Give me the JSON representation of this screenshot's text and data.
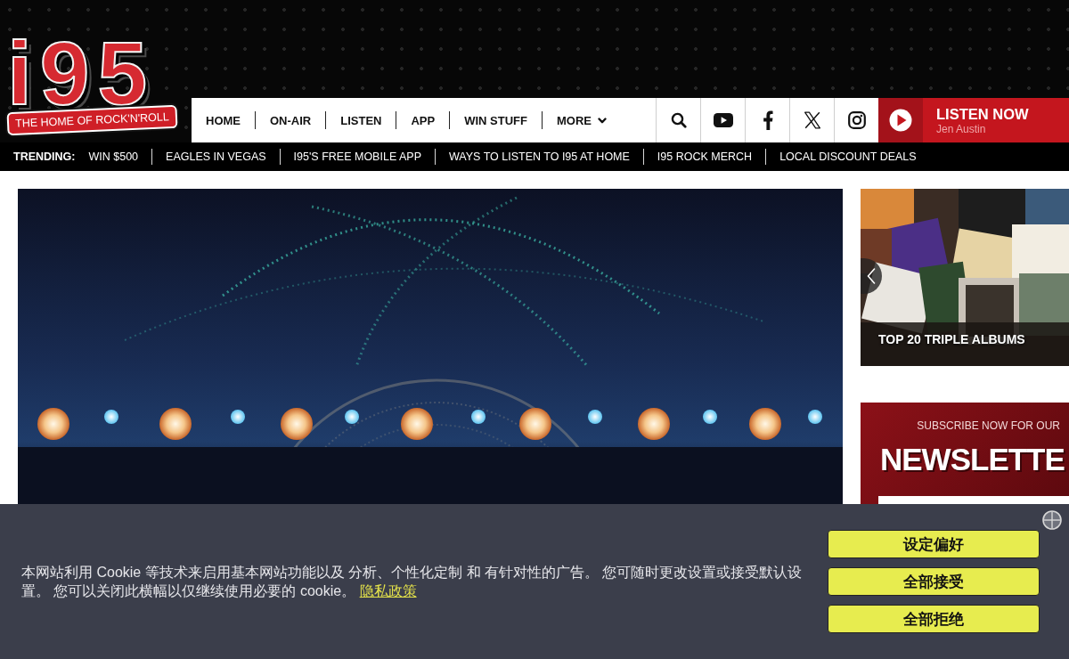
{
  "header": {
    "logo": {
      "wordmark": "i95",
      "tagline": "THE HOME OF ROCK'N'ROLL"
    },
    "nav": [
      {
        "label": "HOME",
        "kind": "link"
      },
      {
        "label": "ON-AIR",
        "kind": "link"
      },
      {
        "label": "LISTEN",
        "kind": "link"
      },
      {
        "label": "APP",
        "kind": "link"
      },
      {
        "label": "WIN STUFF",
        "kind": "link"
      },
      {
        "label": "MORE",
        "kind": "menu"
      }
    ],
    "listen_now": {
      "label": "LISTEN NOW",
      "host": "Jen Austin"
    }
  },
  "trending": {
    "label": "TRENDING:",
    "items": [
      "WIN $500",
      "EAGLES IN VEGAS",
      "I95'S FREE MOBILE APP",
      "WAYS TO LISTEN TO I95 AT HOME",
      "I95 ROCK MERCH",
      "LOCAL DISCOUNT DEALS"
    ]
  },
  "sidebar": {
    "feature": {
      "caption": "TOP 20 TRIPLE ALBUMS"
    },
    "newsletter": {
      "kicker": "SUBSCRIBE NOW FOR OUR",
      "title": "NEWSLETTE"
    }
  },
  "cookie_banner": {
    "text": "本网站利用 Cookie 等技术来启用基本网站功能以及 分析、个性化定制 和 有针对性的广告。 您可随时更改设置或接受默认设置。 您可以关闭此横幅以仅继续使用必要的 cookie。",
    "link": "隐私政策",
    "buttons": [
      "设定偏好",
      "全部接受",
      "全部拒绝"
    ]
  }
}
